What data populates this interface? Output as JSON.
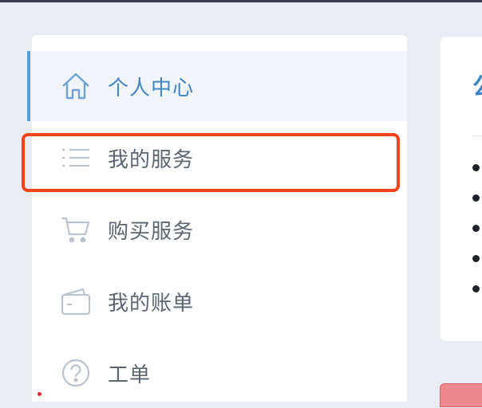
{
  "sidebar": {
    "items": [
      {
        "label": "个人中心",
        "icon": "home-icon",
        "active": true
      },
      {
        "label": "我的服务",
        "icon": "list-icon",
        "active": false
      },
      {
        "label": "购买服务",
        "icon": "cart-icon",
        "active": false
      },
      {
        "label": "我的账单",
        "icon": "wallet-icon",
        "active": false
      },
      {
        "label": "工单",
        "icon": "help-circle-icon",
        "active": false
      }
    ]
  },
  "content": {
    "title_fragment": "公"
  },
  "colors": {
    "accent": "#3f86c4",
    "highlight": "#f2441d",
    "background": "#e9edf3"
  }
}
